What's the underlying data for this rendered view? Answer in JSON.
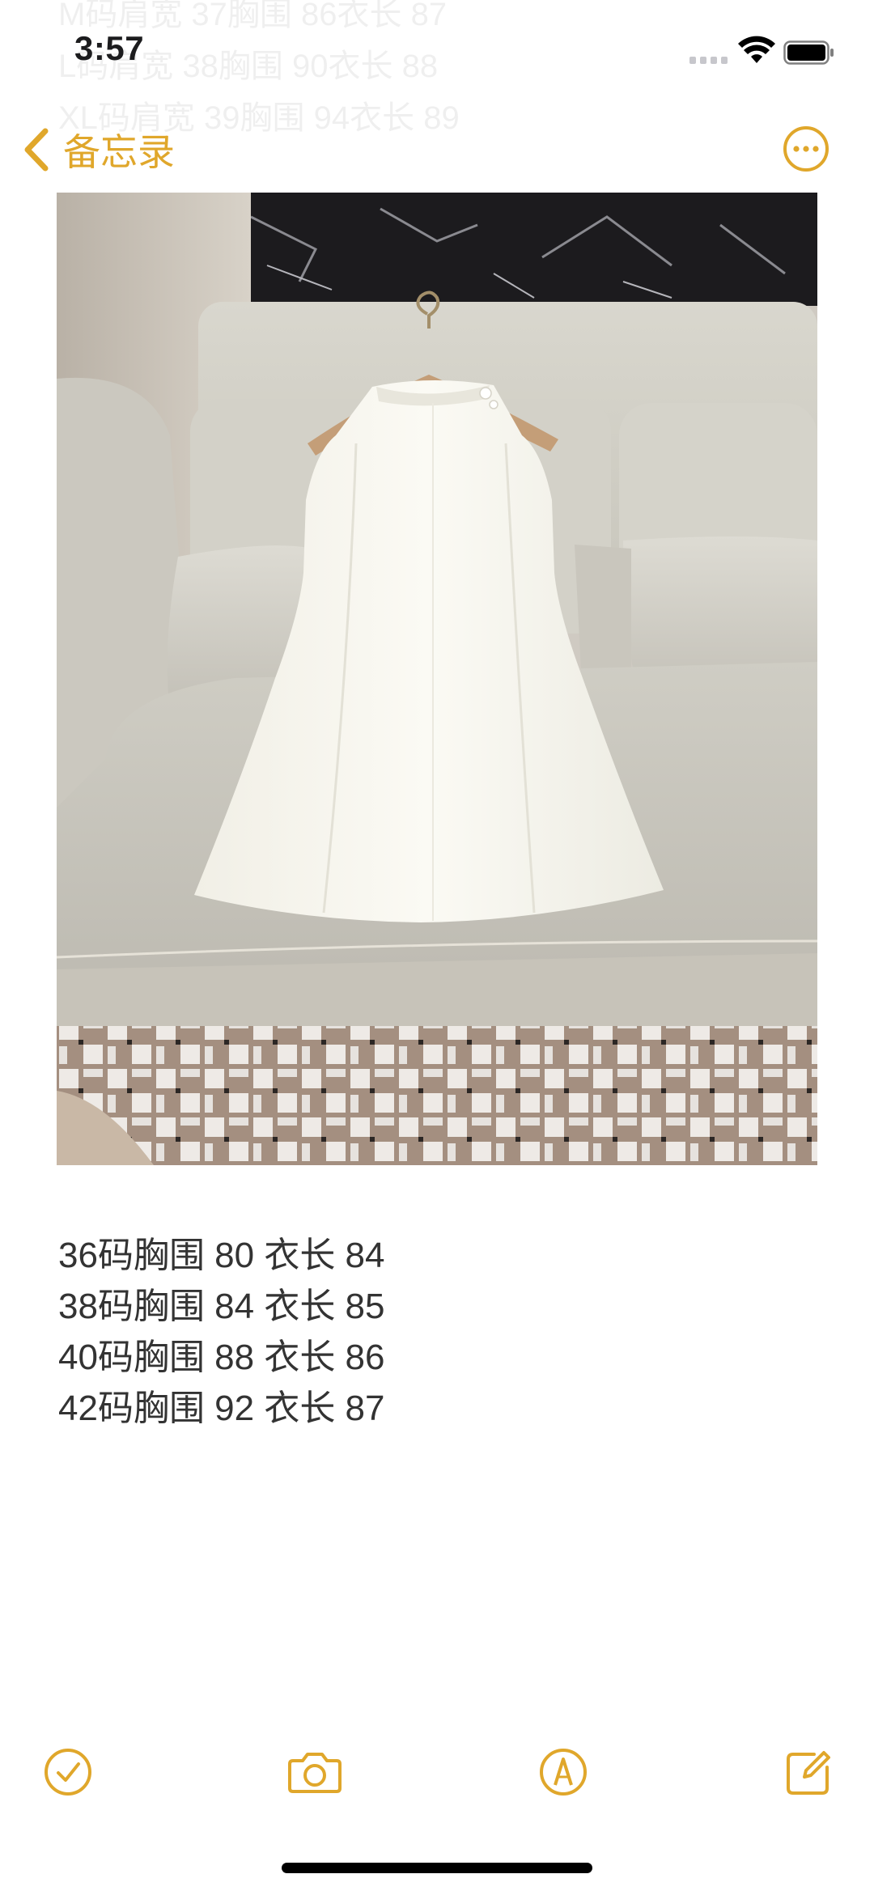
{
  "status_bar": {
    "time": "3:57"
  },
  "ghost_lines": [
    "M码肩宽 37胸围 86衣长 87",
    "L码肩宽 38胸围 90衣长 88",
    "XL码肩宽 39胸围 94衣长 89"
  ],
  "nav": {
    "back_label": "备忘录"
  },
  "note": {
    "lines": [
      "36码胸围 80 衣长 84",
      "38码胸围 84 衣长 85",
      "40码胸围 88 衣长 86",
      "42码胸围 92 衣长 87"
    ]
  },
  "colors": {
    "accent": "#e0a72b",
    "text": "#333333"
  },
  "icons": {
    "back": "chevron-left-icon",
    "more": "ellipsis-circle-icon",
    "checklist": "checkmark-circle-icon",
    "camera": "camera-icon",
    "markup": "pen-tip-circle-icon",
    "compose": "compose-icon"
  }
}
